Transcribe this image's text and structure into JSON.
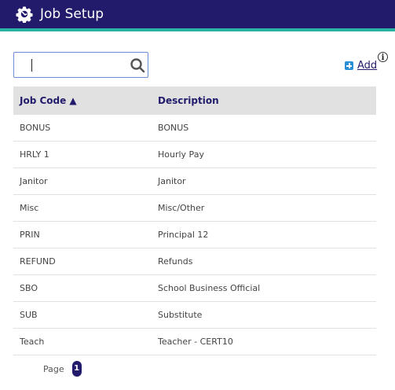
{
  "header": {
    "title": "Job Setup"
  },
  "search": {
    "value": "",
    "placeholder": ""
  },
  "toolbar": {
    "add_label": "Add",
    "info_glyph": "i"
  },
  "table": {
    "columns": [
      "Job Code ▲",
      "Description"
    ],
    "rows": [
      [
        "BONUS",
        "BONUS"
      ],
      [
        "HRLY 1",
        "Hourly Pay"
      ],
      [
        "Janitor",
        "Janitor"
      ],
      [
        "Misc",
        "Misc/Other"
      ],
      [
        "PRIN",
        "Principal 12"
      ],
      [
        "REFUND",
        "Refunds"
      ],
      [
        "SBO",
        "School Business Official"
      ],
      [
        "SUB",
        "Substitute"
      ],
      [
        "Teach",
        "Teacher - CERT10"
      ]
    ]
  },
  "pager": {
    "label": "Page",
    "current": "1"
  },
  "colors": {
    "header": "#221b6b",
    "accent_stripe": "#2bb3a2",
    "add_icon": "#2b8fd6"
  },
  "icons": {
    "header": "gear-icon",
    "search": "search-icon",
    "add": "plus-square-icon",
    "info": "info-icon"
  }
}
